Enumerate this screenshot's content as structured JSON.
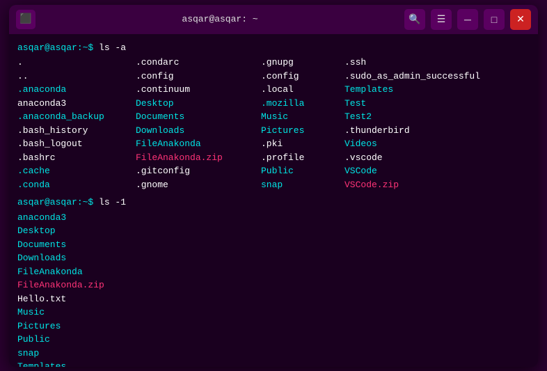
{
  "titlebar": {
    "title": "asqar@asqar: ~",
    "icon": "⬛"
  },
  "terminal": {
    "prompt1": "asqar@asqar:~$ ls -a",
    "prompt2": "asqar@asqar:~$ ls -1",
    "columns": [
      [
        {
          "text": ".",
          "color": "white"
        },
        {
          "text": "..",
          "color": "white"
        },
        {
          "text": ".anaconda",
          "color": "cyan"
        },
        {
          "text": "anaconda3",
          "color": "white"
        },
        {
          "text": ".anaconda_backup",
          "color": "cyan"
        },
        {
          "text": ".bash_history",
          "color": "white"
        },
        {
          "text": ".bash_logout",
          "color": "white"
        },
        {
          "text": ".bashrc",
          "color": "white"
        },
        {
          "text": ".cache",
          "color": "cyan"
        },
        {
          "text": ".conda",
          "color": "cyan"
        }
      ],
      [
        {
          "text": ".condarc",
          "color": "white"
        },
        {
          "text": ".config",
          "color": "white"
        },
        {
          "text": ".continuum",
          "color": "white"
        },
        {
          "text": "Desktop",
          "color": "cyan"
        },
        {
          "text": "Documents",
          "color": "cyan"
        },
        {
          "text": "Downloads",
          "color": "cyan"
        },
        {
          "text": "FileAnakonda",
          "color": "cyan"
        },
        {
          "text": "FileAnakonda.zip",
          "color": "red"
        },
        {
          "text": ".gitconfig",
          "color": "white"
        },
        {
          "text": ".gnome",
          "color": "white"
        }
      ],
      [
        {
          "text": ".gnupg",
          "color": "white"
        },
        {
          "text": ".config",
          "color": "white"
        },
        {
          "text": ".local",
          "color": "white"
        },
        {
          "text": ".mozilla",
          "color": "white"
        },
        {
          "text": "Music",
          "color": "cyan"
        },
        {
          "text": "Pictures",
          "color": "cyan"
        },
        {
          "text": ".pki",
          "color": "white"
        },
        {
          "text": ".profile",
          "color": "white"
        },
        {
          "text": "Public",
          "color": "cyan"
        },
        {
          "text": "snap",
          "color": "cyan"
        }
      ],
      [
        {
          "text": ".ssh",
          "color": "white"
        },
        {
          "text": ".sudo_as_admin_successful",
          "color": "white"
        },
        {
          "text": "Templates",
          "color": "cyan"
        },
        {
          "text": "Test",
          "color": "cyan"
        },
        {
          "text": "Test2",
          "color": "cyan"
        },
        {
          "text": ".thunderbird",
          "color": "white"
        },
        {
          "text": "Videos",
          "color": "cyan"
        },
        {
          "text": ".vscode",
          "color": "white"
        },
        {
          "text": "VSCode",
          "color": "cyan"
        },
        {
          "text": "VSCode.zip",
          "color": "red"
        }
      ]
    ],
    "ls1_items": [
      {
        "text": "anaconda3",
        "color": "cyan"
      },
      {
        "text": "Desktop",
        "color": "cyan"
      },
      {
        "text": "Documents",
        "color": "cyan"
      },
      {
        "text": "Downloads",
        "color": "cyan"
      },
      {
        "text": "FileAnakonda",
        "color": "cyan"
      },
      {
        "text": "FileAnakonda.zip",
        "color": "red"
      },
      {
        "text": "Hello.txt",
        "color": "white"
      },
      {
        "text": "Music",
        "color": "cyan"
      },
      {
        "text": "Pictures",
        "color": "cyan"
      },
      {
        "text": "Public",
        "color": "cyan"
      },
      {
        "text": "snap",
        "color": "cyan"
      },
      {
        "text": "Templates",
        "color": "cyan"
      }
    ],
    "hello_txt_special": "Hello.txt"
  }
}
